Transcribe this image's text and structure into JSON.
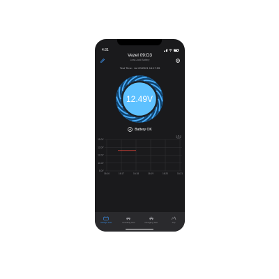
{
  "status_bar": {
    "time": "4:31"
  },
  "header": {
    "title": "Vezel 09:D3",
    "subtitle": "Lead-Acid Battery",
    "edit_icon": "pencil-icon",
    "settings_icon": "gear-icon"
  },
  "test_time": {
    "label": "Test Time:",
    "value": "Jul 20/2021 16:17:55"
  },
  "gauge": {
    "voltage": "12.49V",
    "accent_color": "#4fb3ff",
    "fill_color": "#5ec1ff"
  },
  "battery_status": {
    "text": "Battery OK",
    "icon": "check-circle-icon"
  },
  "chart_data": {
    "type": "line",
    "x": [
      "16:16",
      "16:17",
      "16:18",
      "16:19",
      "16:20",
      "16:21"
    ],
    "y_ticks": [
      "15.0V",
      "13.0V",
      "12.0V",
      "11.0V",
      "8.0V"
    ],
    "series": [
      {
        "values": [
          12.6,
          12.6,
          12.6
        ],
        "x_range": [
          "16:17",
          "16:18"
        ],
        "color": "#e0453a"
      }
    ],
    "export_icon": "share-icon",
    "grid": true
  },
  "tabs": [
    {
      "label": "Voltage Test",
      "icon": "battery-icon",
      "active": true
    },
    {
      "label": "Cranking Test",
      "icon": "car-icon",
      "active": false
    },
    {
      "label": "Charging Test",
      "icon": "charging-car-icon",
      "active": false
    },
    {
      "label": "Trip",
      "icon": "trip-icon",
      "active": false
    }
  ]
}
